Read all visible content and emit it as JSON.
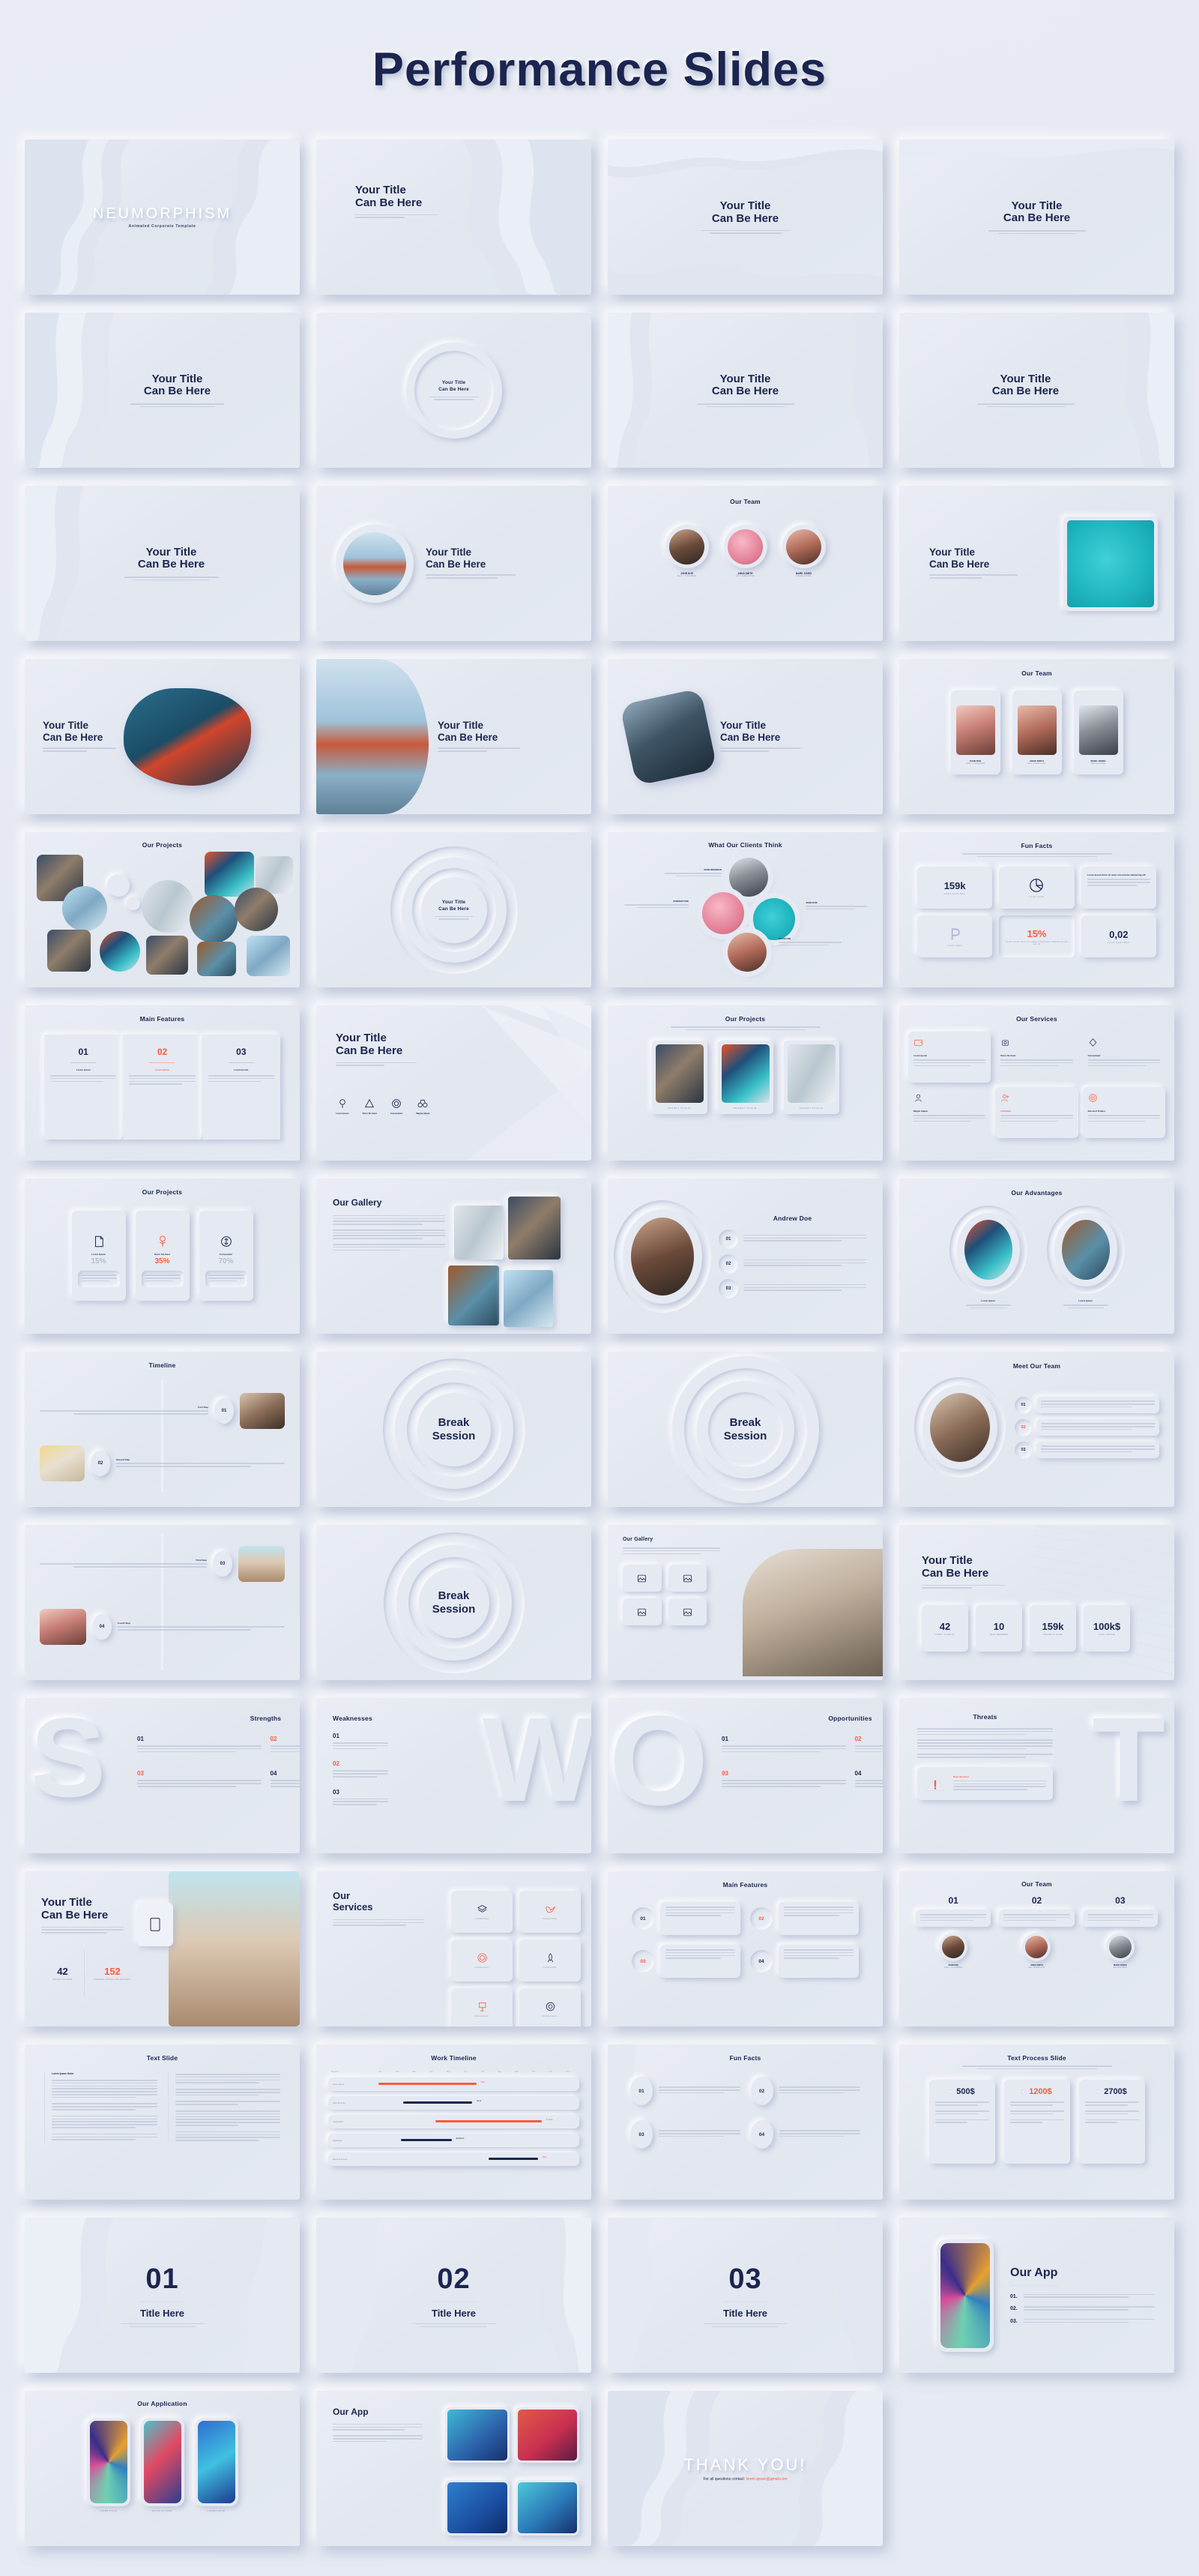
{
  "header": {
    "title": "Performance Slides"
  },
  "accent": "#ff5a3c",
  "ink": "#1b2550",
  "common": {
    "your_title_l1": "Your Title",
    "your_title_l2": "Can Be Here",
    "lorem_short": "Lorem ipsum dolor sit amet, consectetur adipiscing elit sed do eiusmod.",
    "lorem_medium": "Lorem ipsum dolor sit amet, consectetur adipiscing elit, sed do eiusmod tempor incididunt ut labore et dolore magna aliqua ut enim."
  },
  "slides": [
    {
      "id": 1,
      "name": "cover",
      "title": "NEUMORPHISM",
      "subtitle": "Animated Corporate Template"
    },
    {
      "id": 2,
      "name": "title-wave-right",
      "title_l1": "Your Title",
      "title_l2": "Can Be Here"
    },
    {
      "id": 3,
      "name": "title-wave-top",
      "title_l1": "Your Title",
      "title_l2": "Can Be Here"
    },
    {
      "id": 4,
      "name": "title-plain",
      "title_l1": "Your Title",
      "title_l2": "Can Be Here"
    },
    {
      "id": 5,
      "name": "title-left-wave",
      "title_l1": "Your Title",
      "title_l2": "Can Be Here"
    },
    {
      "id": 6,
      "name": "title-circle",
      "title_l1": "Your Title",
      "title_l2": "Can Be Here"
    },
    {
      "id": 7,
      "name": "title-wave-left",
      "title_l1": "Your Title",
      "title_l2": "Can Be Here"
    },
    {
      "id": 8,
      "name": "title-wave-right2",
      "title_l1": "Your Title",
      "title_l2": "Can Be Here"
    },
    {
      "id": 9,
      "name": "title-wave-soft",
      "title_l1": "Your Title",
      "title_l2": "Can Be Here"
    },
    {
      "id": 10,
      "name": "title-photo-circle",
      "title_l1": "Your Title",
      "title_l2": "Can Be Here"
    },
    {
      "id": 11,
      "name": "our-team-3",
      "title": "Our Team",
      "members": [
        {
          "name": "JOHN DOE",
          "role": "CEO / FOUNDER"
        },
        {
          "name": "ANNA SMITH",
          "role": "ART DIRECTOR"
        },
        {
          "name": "MARK JONES",
          "role": "DEVELOPER"
        }
      ]
    },
    {
      "id": 12,
      "name": "title-photo-teal",
      "title_l1": "Your Title",
      "title_l2": "Can Be Here"
    },
    {
      "id": 13,
      "name": "title-boat",
      "title_l1": "Your Title",
      "title_l2": "Can Be Here"
    },
    {
      "id": 14,
      "name": "title-bridge",
      "title_l1": "Your Title",
      "title_l2": "Can Be Here"
    },
    {
      "id": 15,
      "name": "title-forest",
      "title_l1": "Your Title",
      "title_l2": "Can Be Here"
    },
    {
      "id": 16,
      "name": "our-team-cards",
      "title": "Our Team",
      "members": [
        {
          "name": "JOHN DOE",
          "role": "CEO / FOUNDER"
        },
        {
          "name": "ANNA SMITH",
          "role": "ART DIRECTOR"
        },
        {
          "name": "MARK JONES",
          "role": "DEVELOPER"
        }
      ]
    },
    {
      "id": 17,
      "name": "our-projects-circles",
      "title": "Our Projects"
    },
    {
      "id": 18,
      "name": "title-rings",
      "title_l1": "Your Title",
      "title_l2": "Can Be Here"
    },
    {
      "id": 19,
      "name": "clients-think",
      "title": "What Our Clients Think",
      "clients": [
        {
          "name": "JOHN BRENNAN",
          "quote": "Lorem ipsum dolor sit amet, consectetur adipiscing elit."
        },
        {
          "name": "ANDREW DOE",
          "quote": "Lorem ipsum dolor sit amet, consectetur adipiscing elit."
        },
        {
          "name": "JOHN DOE",
          "quote": "Lorem ipsum dolor sit amet, consectetur adipiscing elit."
        },
        {
          "name": "MARIA KIM",
          "quote": "Lorem ipsum dolor sit amet, consectetur adipiscing elit."
        }
      ]
    },
    {
      "id": 20,
      "name": "fun-facts-grid",
      "title": "Fun Facts",
      "cells": [
        {
          "value": "159k",
          "label": "Lorem ipsum dolor"
        },
        {
          "value": "",
          "label": "Lorem ipsum",
          "icon": "pie-chart-icon"
        },
        {
          "value": "",
          "label": "Lorem ipsum dolor sit amet consectetur adipiscing elit"
        },
        {
          "value": "",
          "label": "Lorem ipsum",
          "icon": "p-letter-icon"
        },
        {
          "value": "15%",
          "label": "Lorem ipsum dolor sit amet consectetur adipiscing elit sed do",
          "accent": true
        },
        {
          "value": "0,02",
          "label": "Lorem ipsum dolor"
        }
      ]
    },
    {
      "id": 21,
      "name": "main-features-3",
      "title": "Main Features",
      "features": [
        {
          "num": "01",
          "label": "Lorem ipsum",
          "accent": false
        },
        {
          "num": "02",
          "label": "Lorem ipsum",
          "accent": true
        },
        {
          "num": "03",
          "label": "Lorem ipsum",
          "accent": false
        }
      ]
    },
    {
      "id": 22,
      "name": "title-icons-row",
      "title_l1": "Your Title",
      "title_l2": "Can Be Here",
      "icons": [
        {
          "label": "Lorem Ipsum",
          "icon": "pin-icon"
        },
        {
          "label": "Dolor Sit Amet",
          "icon": "triangle-icon"
        },
        {
          "label": "Consectetur",
          "icon": "circle-icon"
        },
        {
          "label": "Magna Aliqua",
          "icon": "binocular-icon"
        }
      ]
    },
    {
      "id": 23,
      "name": "our-projects-photos",
      "title": "Our Projects",
      "projects": [
        {
          "caption": "PROJECT TITLE 01"
        },
        {
          "caption": "PROJECT TITLE 02"
        },
        {
          "caption": "PROJECT TITLE 03"
        }
      ]
    },
    {
      "id": 24,
      "name": "our-services-6",
      "title": "Our Services",
      "services": [
        {
          "title": "Lorem Ipsum",
          "icon": "wallet-icon",
          "accent": true
        },
        {
          "title": "Dolor Sit Amet",
          "icon": "camera-icon",
          "accent": false
        },
        {
          "title": "Consectetur",
          "icon": "diamond-icon",
          "accent": false
        },
        {
          "title": "Magna Aliqua",
          "icon": "person-icon",
          "accent": false
        },
        {
          "title": "Incididunt",
          "icon": "user-add-icon",
          "accent": true
        },
        {
          "title": "Eiusmod Tempor",
          "icon": "target-icon",
          "accent": true
        }
      ]
    },
    {
      "id": 25,
      "name": "our-projects-stats",
      "title": "Our Projects",
      "cards": [
        {
          "title": "Lorem Ipsum",
          "value": "15%",
          "accent": false,
          "icon": "file-icon"
        },
        {
          "title": "Dolor Sit Amet",
          "value": "35%",
          "accent": true,
          "icon": "money-plant-icon"
        },
        {
          "title": "Consectetur",
          "value": "70%",
          "accent": false,
          "icon": "coin-icon"
        }
      ]
    },
    {
      "id": 26,
      "name": "our-gallery-4",
      "title": "Our Gallery"
    },
    {
      "id": 27,
      "name": "andrew-doe",
      "title": "Andrew Doe",
      "points": [
        {
          "num": "01"
        },
        {
          "num": "02"
        },
        {
          "num": "03"
        }
      ]
    },
    {
      "id": 28,
      "name": "our-advantages",
      "title": "Our Advantages",
      "items": [
        {
          "label": "Lorem Ipsum"
        },
        {
          "label": "Lorem Ipsum"
        }
      ]
    },
    {
      "id": 29,
      "name": "timeline",
      "title": "Timeline",
      "steps": [
        {
          "num": "01",
          "label": "First Step"
        },
        {
          "num": "02",
          "label": "Second Step"
        }
      ]
    },
    {
      "id": 30,
      "name": "break-session-1",
      "title_l1": "Break",
      "title_l2": "Session"
    },
    {
      "id": 31,
      "name": "break-session-2",
      "title_l1": "Break",
      "title_l2": "Session"
    },
    {
      "id": 32,
      "name": "meet-our-team",
      "title": "Meet Our Team",
      "rows": [
        {
          "num": "01",
          "accent": false
        },
        {
          "num": "02",
          "accent": true
        },
        {
          "num": "03",
          "accent": false
        }
      ]
    },
    {
      "id": 33,
      "name": "timeline-cont",
      "steps": [
        {
          "num": "03",
          "label": "Third Step"
        },
        {
          "num": "04",
          "label": "Fourth Step"
        }
      ]
    },
    {
      "id": 34,
      "name": "break-session-3",
      "title_l1": "Break",
      "title_l2": "Session"
    },
    {
      "id": 35,
      "name": "our-gallery-frames",
      "title": "Our Gallery"
    },
    {
      "id": 36,
      "name": "title-stats-4",
      "title_l1": "Your Title",
      "title_l2": "Can Be Here",
      "stats": [
        {
          "value": "42",
          "label": "HAPPY CLIENTS"
        },
        {
          "value": "10",
          "label": "TEAM MEMBERS"
        },
        {
          "value": "159k",
          "label": "PROJECTS DONE"
        },
        {
          "value": "100k$",
          "label": "CASH INCOME"
        }
      ]
    },
    {
      "id": 37,
      "name": "swot-strengths",
      "title": "Strengths",
      "letter": "S",
      "points": [
        {
          "num": "01",
          "accent": false
        },
        {
          "num": "02",
          "accent": true
        },
        {
          "num": "03",
          "accent": true
        },
        {
          "num": "04",
          "accent": false
        }
      ]
    },
    {
      "id": 38,
      "name": "swot-weaknesses",
      "title": "Weaknesses",
      "letter": "W",
      "points": [
        {
          "num": "01",
          "accent": false
        },
        {
          "num": "02",
          "accent": true
        },
        {
          "num": "03",
          "accent": false
        }
      ]
    },
    {
      "id": 39,
      "name": "swot-opportunities",
      "title": "Opportunities",
      "letter": "O",
      "points": [
        {
          "num": "01",
          "accent": false
        },
        {
          "num": "02",
          "accent": true
        },
        {
          "num": "03",
          "accent": true
        },
        {
          "num": "04",
          "accent": false
        }
      ]
    },
    {
      "id": 40,
      "name": "swot-threats",
      "title": "Threats",
      "letter": "T",
      "warning_title": "Dolor Sit Amet"
    },
    {
      "id": 41,
      "name": "title-building-stats",
      "title_l1": "Your Title",
      "title_l2": "Can Be Here",
      "stats": [
        {
          "value": "42",
          "label": "PROJECTS DONE",
          "accent": false
        },
        {
          "value": "152",
          "label": "AVERAGE HOURS PER PROJECT",
          "accent": true
        }
      ]
    },
    {
      "id": 42,
      "name": "our-services-icons",
      "title_l1": "Our",
      "title_l2": "Services",
      "tiles": [
        {
          "label": "Consectetur",
          "icon": "layers-icon",
          "accent": false
        },
        {
          "label": "Consectetur",
          "icon": "bird-icon",
          "accent": true
        },
        {
          "label": "Consectetur",
          "icon": "spiral-icon",
          "accent": true
        },
        {
          "label": "Consectetur",
          "icon": "rocket-icon",
          "accent": false
        },
        {
          "label": "Consectetur",
          "icon": "easel-icon",
          "accent": true
        },
        {
          "label": "Consectetur",
          "icon": "gear-icon",
          "accent": false
        }
      ]
    },
    {
      "id": 43,
      "name": "main-features-grid",
      "title": "Main Features",
      "cells": [
        {
          "num": "01",
          "accent": false
        },
        {
          "num": "02",
          "accent": true
        },
        {
          "num": "03",
          "accent": true
        },
        {
          "num": "04",
          "accent": false
        }
      ]
    },
    {
      "id": 44,
      "name": "our-team-numbered",
      "title": "Our Team",
      "members": [
        {
          "num": "01",
          "name": "JOHN DOE",
          "role": "CEO / FOUNDER"
        },
        {
          "num": "02",
          "name": "ANNA SMITH",
          "role": "ART DIRECTOR"
        },
        {
          "num": "03",
          "name": "MARK JONES",
          "role": "DEVELOPER"
        }
      ]
    },
    {
      "id": 45,
      "name": "text-slide",
      "title": "Text Slide",
      "lead": "Lorem Ipsum Dolor"
    },
    {
      "id": 46,
      "name": "work-timeline",
      "title": "Work Timeline",
      "columns": [
        "Projects",
        "Jan",
        "Feb",
        "Mar",
        "Apr",
        "May",
        "Jun",
        "Jul",
        "Aug",
        "Sep",
        "Oct",
        "Nov",
        "Dec"
      ],
      "rows": [
        {
          "label": "Lorem Ipsum",
          "owner": "John",
          "accent": true,
          "start": 1,
          "span": 5
        },
        {
          "label": "Dolor Sit Amet",
          "owner": "Anna",
          "accent": false,
          "start": 3,
          "span": 4
        },
        {
          "label": "Consectetur",
          "owner": "Andrew",
          "accent": true,
          "start": 6,
          "span": 6
        },
        {
          "label": "Adipiscing",
          "owner": "Elizabeth",
          "accent": false,
          "start": 3,
          "span": 3
        },
        {
          "label": "Eiusmod Tempor",
          "owner": "Mark",
          "accent": true,
          "start": 8,
          "span": 3
        }
      ]
    },
    {
      "id": 47,
      "name": "fun-facts-circles",
      "title": "Fun Facts",
      "items": [
        {
          "num": "01"
        },
        {
          "num": "02"
        },
        {
          "num": "03"
        },
        {
          "num": "04"
        }
      ]
    },
    {
      "id": 48,
      "name": "text-process-slide",
      "title": "Text Process Slide",
      "cards": [
        {
          "value": "500$",
          "accent": false
        },
        {
          "value": "1200$",
          "accent": true
        },
        {
          "value": "2700$",
          "accent": false
        }
      ]
    },
    {
      "id": 49,
      "name": "section-01",
      "number": "01",
      "title": "Title Here"
    },
    {
      "id": 50,
      "name": "section-02",
      "number": "02",
      "title": "Title Here"
    },
    {
      "id": 51,
      "name": "section-03",
      "number": "03",
      "title": "Title Here"
    },
    {
      "id": 52,
      "name": "our-app-1",
      "title": "Our App",
      "points": [
        {
          "num": "01."
        },
        {
          "num": "02."
        },
        {
          "num": "03."
        }
      ]
    },
    {
      "id": 53,
      "name": "our-application",
      "title": "Our Application",
      "captions": [
        "LOREM IPSUM",
        "DOLOR SIT AMET",
        "CONSECTETUR"
      ]
    },
    {
      "id": 54,
      "name": "our-app-2",
      "title": "Our App"
    },
    {
      "id": 55,
      "name": "thank-you",
      "title": "THANK YOU!",
      "contact_prefix": "For all questions contact: ",
      "contact_email": "lorem.ipsum@gmail.com"
    }
  ]
}
